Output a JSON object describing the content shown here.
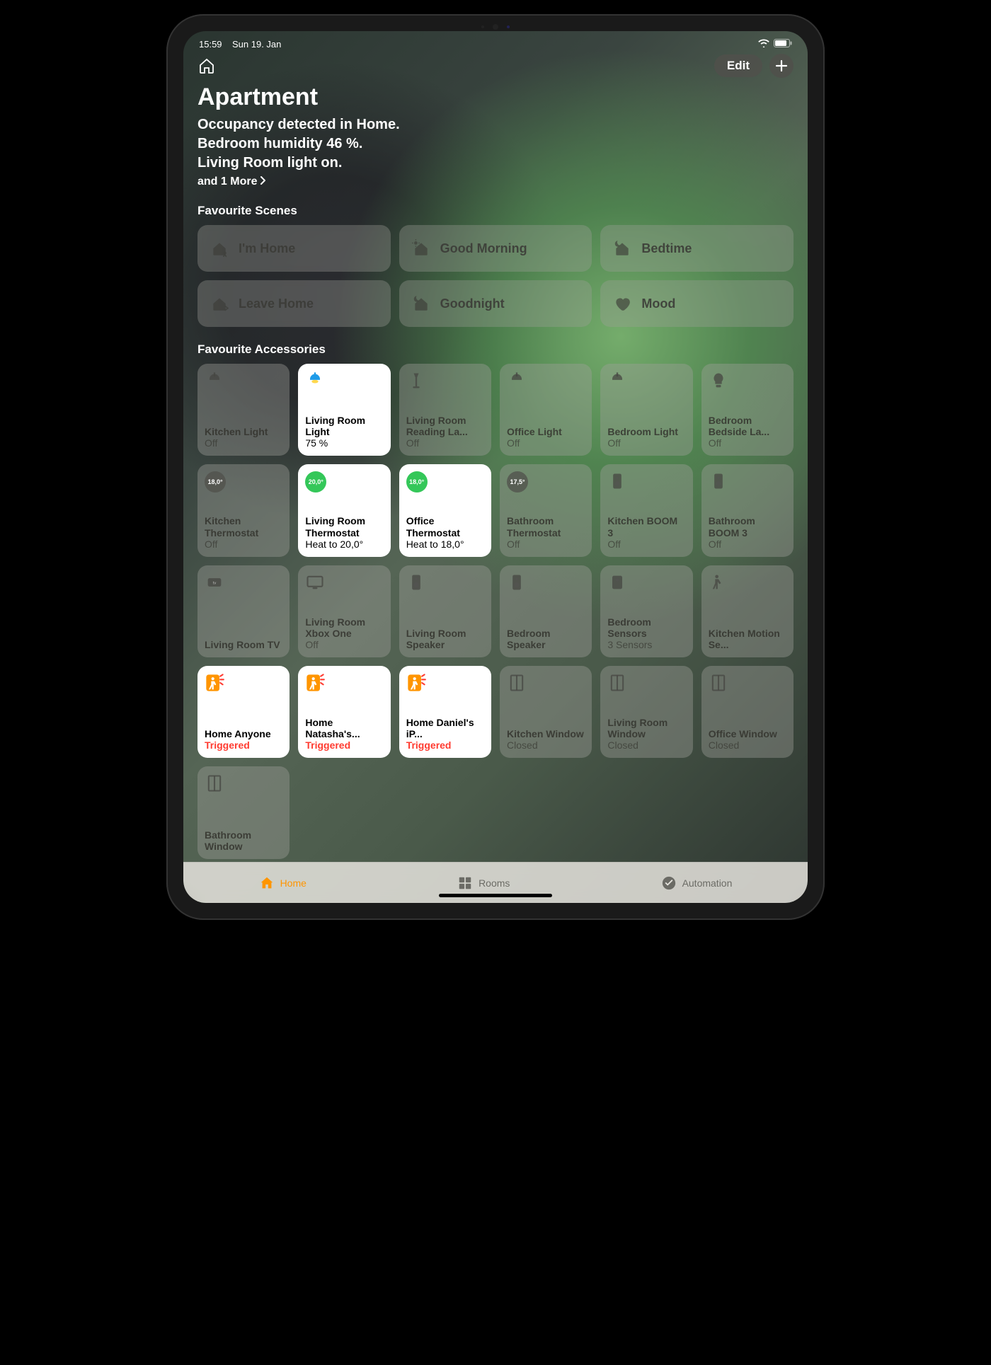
{
  "statusbar": {
    "time": "15:59",
    "date": "Sun 19. Jan"
  },
  "toolbar": {
    "edit_label": "Edit"
  },
  "home": {
    "title": "Apartment",
    "line1": "Occupancy detected in Home.",
    "line2": "Bedroom humidity 46 %.",
    "line3": "Living Room light on.",
    "more": "and 1 More"
  },
  "sections": {
    "scenes_label": "Favourite Scenes",
    "accessories_label": "Favourite Accessories"
  },
  "scenes": [
    {
      "label": "I'm Home",
      "icon": "house-person"
    },
    {
      "label": "Good Morning",
      "icon": "sun-house"
    },
    {
      "label": "Bedtime",
      "icon": "moon-house"
    },
    {
      "label": "Leave Home",
      "icon": "house-leave"
    },
    {
      "label": "Goodnight",
      "icon": "moon-house"
    },
    {
      "label": "Mood",
      "icon": "heart"
    }
  ],
  "accessories": [
    {
      "name": "Kitchen Light",
      "status": "Off",
      "icon": "pendant",
      "active": false
    },
    {
      "name": "Living Room Light",
      "status": "75 %",
      "icon": "pendant-on",
      "active": true
    },
    {
      "name": "Living Room Reading La...",
      "status": "Off",
      "icon": "floorlamp",
      "active": false
    },
    {
      "name": "Office Light",
      "status": "Off",
      "icon": "pendant",
      "active": false
    },
    {
      "name": "Bedroom Light",
      "status": "Off",
      "icon": "pendant",
      "active": false
    },
    {
      "name": "Bedroom Bedside La...",
      "status": "Off",
      "icon": "bulb",
      "active": false
    },
    {
      "name": "Kitchen Thermostat",
      "status": "Off",
      "icon": "thermo-off",
      "badge": "18,0°",
      "active": false
    },
    {
      "name": "Living Room Thermostat",
      "status": "Heat to 20,0°",
      "icon": "thermo-on",
      "badge": "20,0°",
      "active": true
    },
    {
      "name": "Office Thermostat",
      "status": "Heat to 18,0°",
      "icon": "thermo-on",
      "badge": "18,0°",
      "active": true
    },
    {
      "name": "Bathroom Thermostat",
      "status": "Off",
      "icon": "thermo-off",
      "badge": "17,5°",
      "active": false
    },
    {
      "name": "Kitchen BOOM 3",
      "status": "Off",
      "icon": "speaker",
      "active": false
    },
    {
      "name": "Bathroom BOOM 3",
      "status": "Off",
      "icon": "speaker",
      "active": false
    },
    {
      "name": "Living Room TV",
      "status": "",
      "icon": "appletv",
      "active": false
    },
    {
      "name": "Living Room Xbox One",
      "status": "Off",
      "icon": "tv",
      "active": false
    },
    {
      "name": "Living Room Speaker",
      "status": "",
      "icon": "speaker",
      "active": false
    },
    {
      "name": "Bedroom Speaker",
      "status": "",
      "icon": "speaker",
      "active": false
    },
    {
      "name": "Bedroom Sensors",
      "status": "3 Sensors",
      "icon": "sensor",
      "active": false
    },
    {
      "name": "Kitchen Motion Se...",
      "status": "",
      "icon": "motion",
      "active": false
    },
    {
      "name": "Home Anyone",
      "status": "Triggered",
      "icon": "motion-on",
      "active": true,
      "triggered": true
    },
    {
      "name": "Home Natasha's...",
      "status": "Triggered",
      "icon": "motion-on",
      "active": true,
      "triggered": true
    },
    {
      "name": "Home Daniel's iP...",
      "status": "Triggered",
      "icon": "motion-on",
      "active": true,
      "triggered": true
    },
    {
      "name": "Kitchen Window",
      "status": "Closed",
      "icon": "window",
      "active": false
    },
    {
      "name": "Living Room Window",
      "status": "Closed",
      "icon": "window",
      "active": false
    },
    {
      "name": "Office Window",
      "status": "Closed",
      "icon": "window",
      "active": false
    },
    {
      "name": "Bathroom Window",
      "status": "",
      "icon": "window",
      "active": false
    }
  ],
  "tabs": {
    "home": "Home",
    "rooms": "Rooms",
    "automation": "Automation"
  }
}
